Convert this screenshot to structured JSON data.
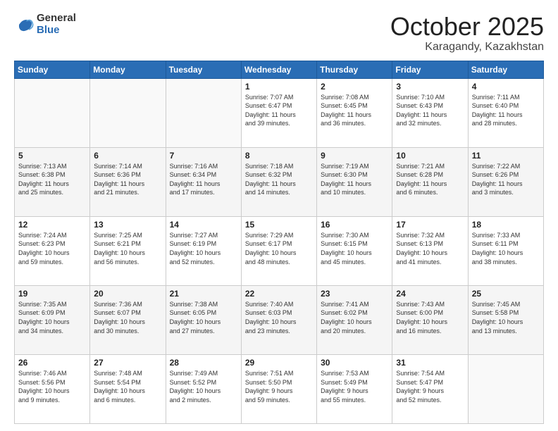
{
  "header": {
    "logo_general": "General",
    "logo_blue": "Blue",
    "month": "October 2025",
    "location": "Karagandy, Kazakhstan"
  },
  "days_of_week": [
    "Sunday",
    "Monday",
    "Tuesday",
    "Wednesday",
    "Thursday",
    "Friday",
    "Saturday"
  ],
  "weeks": [
    [
      {
        "num": "",
        "info": ""
      },
      {
        "num": "",
        "info": ""
      },
      {
        "num": "",
        "info": ""
      },
      {
        "num": "1",
        "info": "Sunrise: 7:07 AM\nSunset: 6:47 PM\nDaylight: 11 hours\nand 39 minutes."
      },
      {
        "num": "2",
        "info": "Sunrise: 7:08 AM\nSunset: 6:45 PM\nDaylight: 11 hours\nand 36 minutes."
      },
      {
        "num": "3",
        "info": "Sunrise: 7:10 AM\nSunset: 6:43 PM\nDaylight: 11 hours\nand 32 minutes."
      },
      {
        "num": "4",
        "info": "Sunrise: 7:11 AM\nSunset: 6:40 PM\nDaylight: 11 hours\nand 28 minutes."
      }
    ],
    [
      {
        "num": "5",
        "info": "Sunrise: 7:13 AM\nSunset: 6:38 PM\nDaylight: 11 hours\nand 25 minutes."
      },
      {
        "num": "6",
        "info": "Sunrise: 7:14 AM\nSunset: 6:36 PM\nDaylight: 11 hours\nand 21 minutes."
      },
      {
        "num": "7",
        "info": "Sunrise: 7:16 AM\nSunset: 6:34 PM\nDaylight: 11 hours\nand 17 minutes."
      },
      {
        "num": "8",
        "info": "Sunrise: 7:18 AM\nSunset: 6:32 PM\nDaylight: 11 hours\nand 14 minutes."
      },
      {
        "num": "9",
        "info": "Sunrise: 7:19 AM\nSunset: 6:30 PM\nDaylight: 11 hours\nand 10 minutes."
      },
      {
        "num": "10",
        "info": "Sunrise: 7:21 AM\nSunset: 6:28 PM\nDaylight: 11 hours\nand 6 minutes."
      },
      {
        "num": "11",
        "info": "Sunrise: 7:22 AM\nSunset: 6:26 PM\nDaylight: 11 hours\nand 3 minutes."
      }
    ],
    [
      {
        "num": "12",
        "info": "Sunrise: 7:24 AM\nSunset: 6:23 PM\nDaylight: 10 hours\nand 59 minutes."
      },
      {
        "num": "13",
        "info": "Sunrise: 7:25 AM\nSunset: 6:21 PM\nDaylight: 10 hours\nand 56 minutes."
      },
      {
        "num": "14",
        "info": "Sunrise: 7:27 AM\nSunset: 6:19 PM\nDaylight: 10 hours\nand 52 minutes."
      },
      {
        "num": "15",
        "info": "Sunrise: 7:29 AM\nSunset: 6:17 PM\nDaylight: 10 hours\nand 48 minutes."
      },
      {
        "num": "16",
        "info": "Sunrise: 7:30 AM\nSunset: 6:15 PM\nDaylight: 10 hours\nand 45 minutes."
      },
      {
        "num": "17",
        "info": "Sunrise: 7:32 AM\nSunset: 6:13 PM\nDaylight: 10 hours\nand 41 minutes."
      },
      {
        "num": "18",
        "info": "Sunrise: 7:33 AM\nSunset: 6:11 PM\nDaylight: 10 hours\nand 38 minutes."
      }
    ],
    [
      {
        "num": "19",
        "info": "Sunrise: 7:35 AM\nSunset: 6:09 PM\nDaylight: 10 hours\nand 34 minutes."
      },
      {
        "num": "20",
        "info": "Sunrise: 7:36 AM\nSunset: 6:07 PM\nDaylight: 10 hours\nand 30 minutes."
      },
      {
        "num": "21",
        "info": "Sunrise: 7:38 AM\nSunset: 6:05 PM\nDaylight: 10 hours\nand 27 minutes."
      },
      {
        "num": "22",
        "info": "Sunrise: 7:40 AM\nSunset: 6:03 PM\nDaylight: 10 hours\nand 23 minutes."
      },
      {
        "num": "23",
        "info": "Sunrise: 7:41 AM\nSunset: 6:02 PM\nDaylight: 10 hours\nand 20 minutes."
      },
      {
        "num": "24",
        "info": "Sunrise: 7:43 AM\nSunset: 6:00 PM\nDaylight: 10 hours\nand 16 minutes."
      },
      {
        "num": "25",
        "info": "Sunrise: 7:45 AM\nSunset: 5:58 PM\nDaylight: 10 hours\nand 13 minutes."
      }
    ],
    [
      {
        "num": "26",
        "info": "Sunrise: 7:46 AM\nSunset: 5:56 PM\nDaylight: 10 hours\nand 9 minutes."
      },
      {
        "num": "27",
        "info": "Sunrise: 7:48 AM\nSunset: 5:54 PM\nDaylight: 10 hours\nand 6 minutes."
      },
      {
        "num": "28",
        "info": "Sunrise: 7:49 AM\nSunset: 5:52 PM\nDaylight: 10 hours\nand 2 minutes."
      },
      {
        "num": "29",
        "info": "Sunrise: 7:51 AM\nSunset: 5:50 PM\nDaylight: 9 hours\nand 59 minutes."
      },
      {
        "num": "30",
        "info": "Sunrise: 7:53 AM\nSunset: 5:49 PM\nDaylight: 9 hours\nand 55 minutes."
      },
      {
        "num": "31",
        "info": "Sunrise: 7:54 AM\nSunset: 5:47 PM\nDaylight: 9 hours\nand 52 minutes."
      },
      {
        "num": "",
        "info": ""
      }
    ]
  ]
}
